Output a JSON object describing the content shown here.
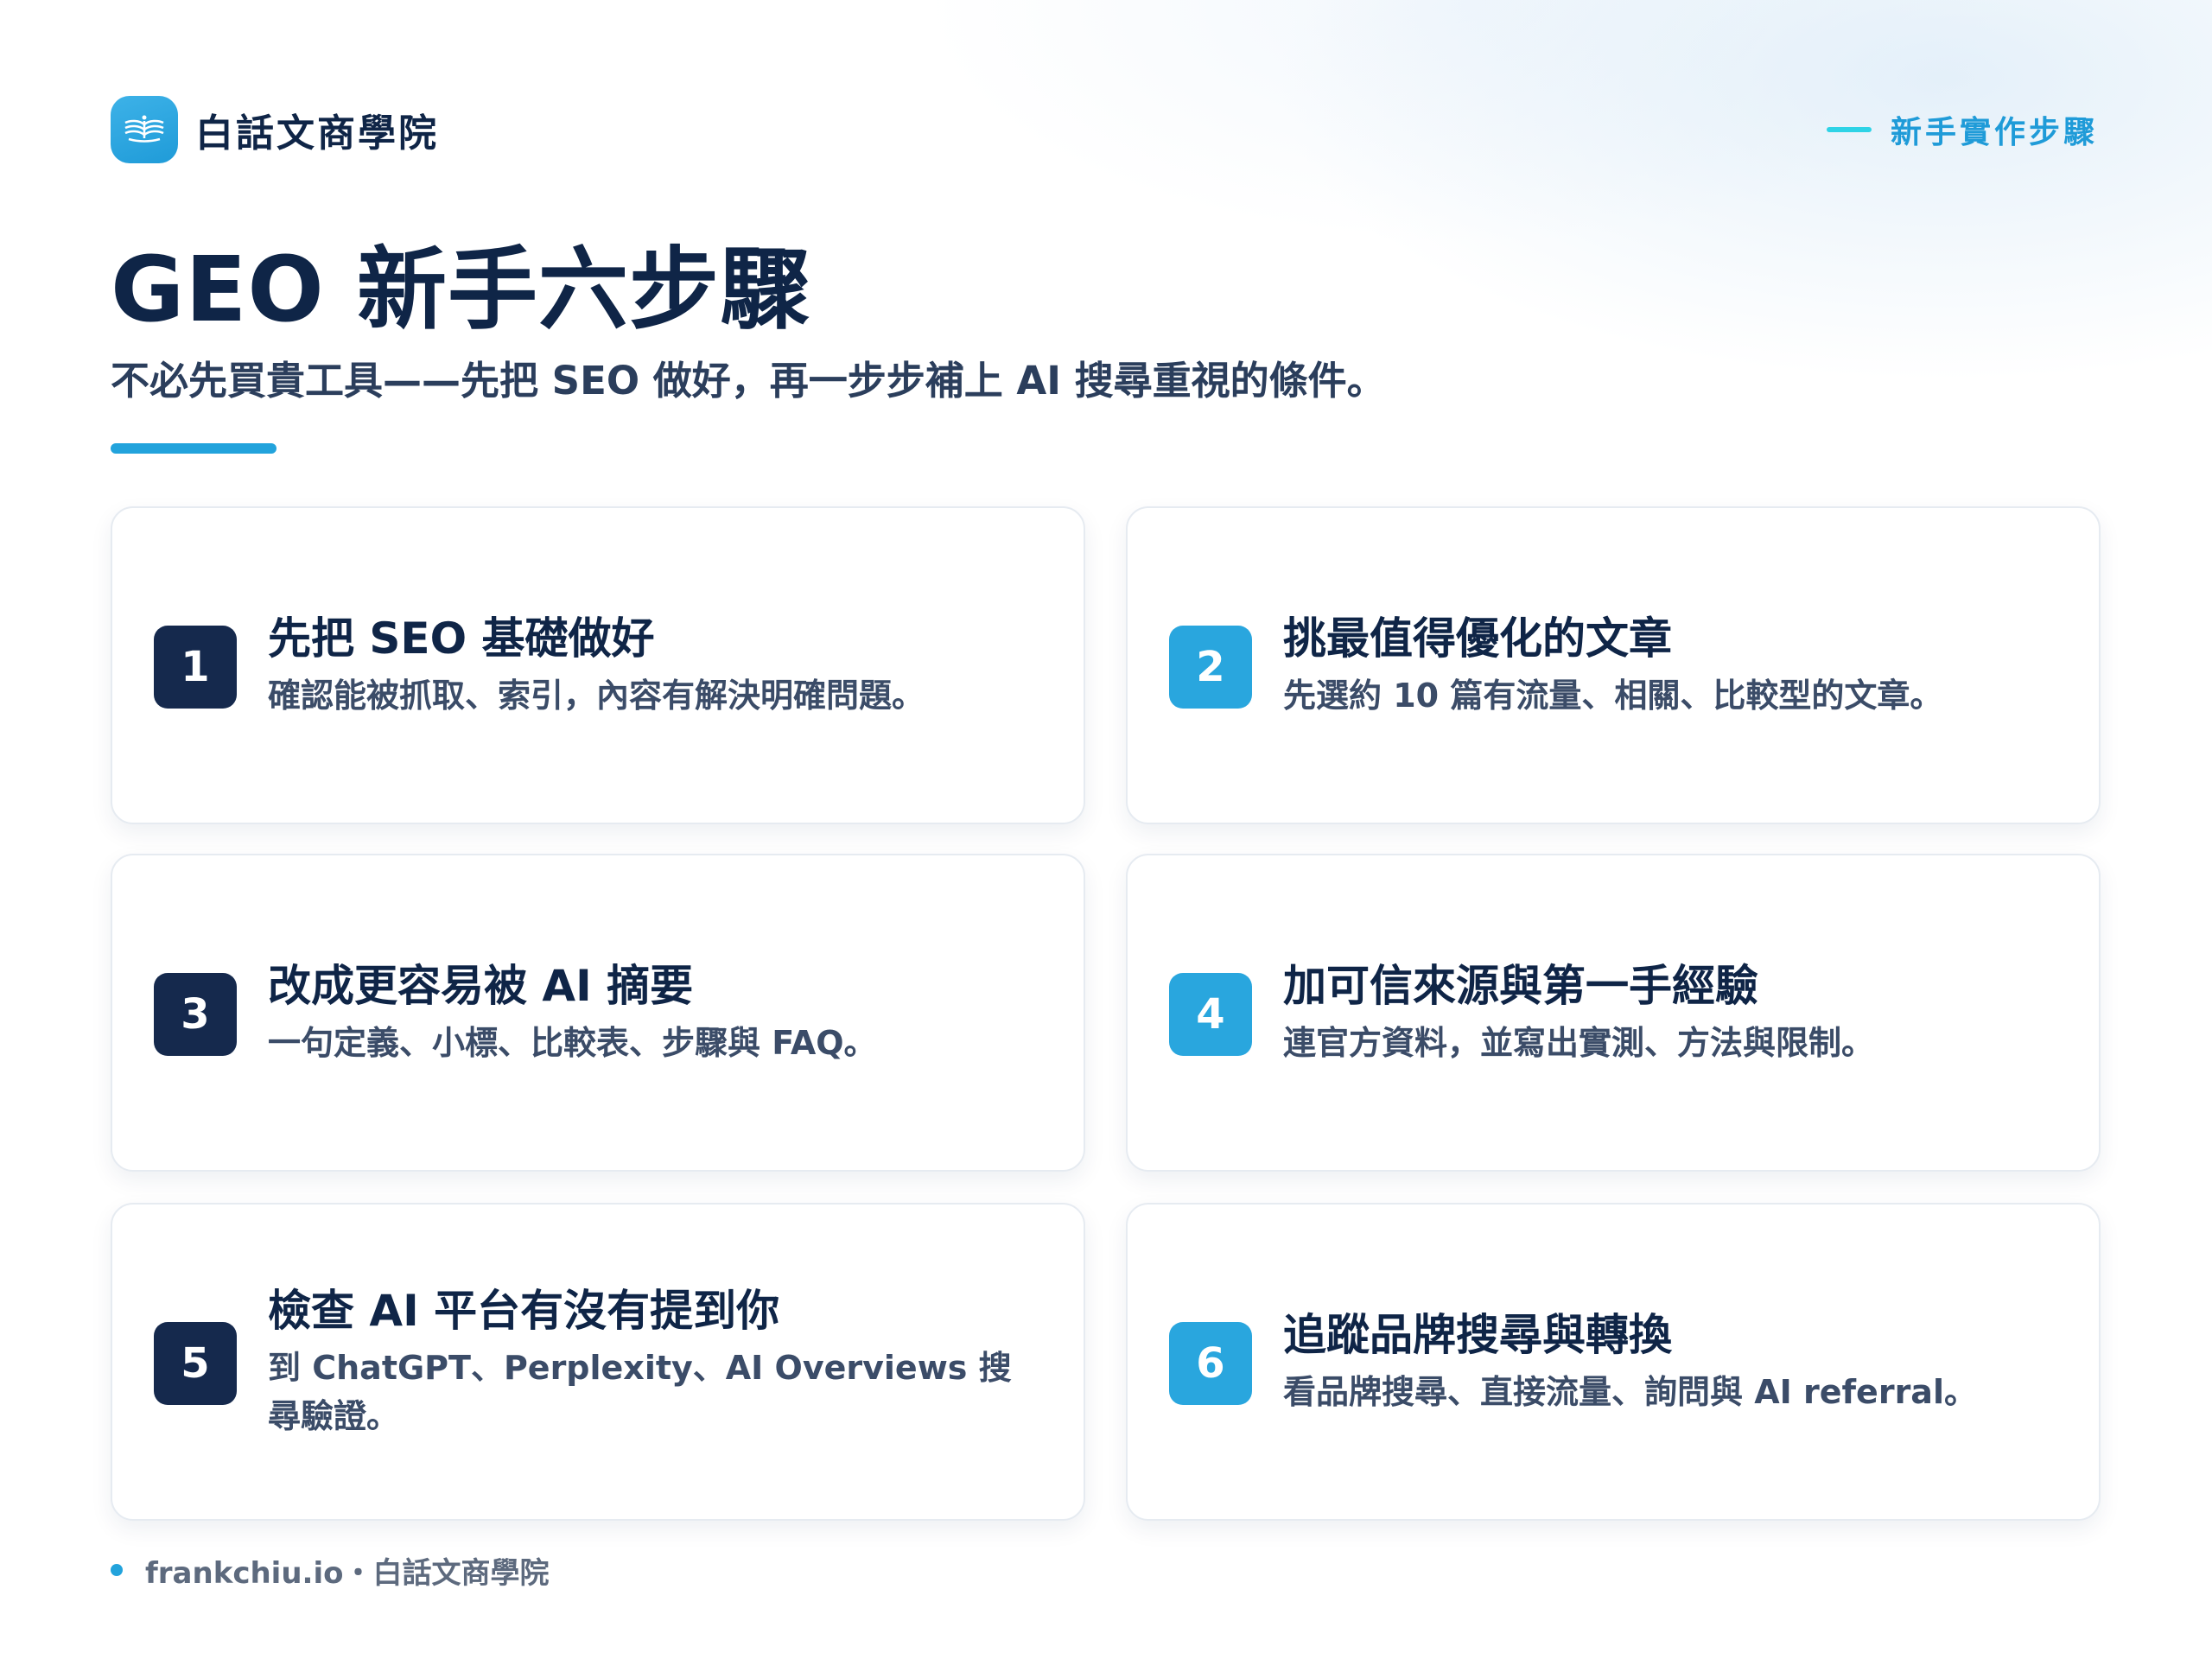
{
  "brand": {
    "name": "白話文商學院",
    "logo_icon": "open-book-icon"
  },
  "section_tag": "新手實作步驟",
  "title": "GEO 新手六步驟",
  "subtitle": "不必先買貴工具——先把 SEO 做好，再一步步補上 AI 搜尋重視的條件。",
  "colors": {
    "navy": "#0f2547",
    "accent": "#22a3dc",
    "cyan": "#2ed3e6",
    "badge_dark": "#15294d",
    "badge_light": "#29a6de"
  },
  "steps": [
    {
      "number": "1",
      "title": "先把 SEO 基礎做好",
      "desc": "確認能被抓取、索引，內容有解決明確問題。"
    },
    {
      "number": "2",
      "title": "挑最值得優化的文章",
      "desc": "先選約 10 篇有流量、相關、比較型的文章。"
    },
    {
      "number": "3",
      "title": "改成更容易被 AI 摘要",
      "desc": "一句定義、小標、比較表、步驟與 FAQ。"
    },
    {
      "number": "4",
      "title": "加可信來源與第一手經驗",
      "desc": "連官方資料，並寫出實測、方法與限制。"
    },
    {
      "number": "5",
      "title": "檢查 AI 平台有沒有提到你",
      "desc": "到 ChatGPT、Perplexity、AI Overviews 搜尋驗證。"
    },
    {
      "number": "6",
      "title": "追蹤品牌搜尋與轉換",
      "desc": "看品牌搜尋、直接流量、詢問與 AI referral。"
    }
  ],
  "footer": "frankchiu.io・白話文商學院"
}
